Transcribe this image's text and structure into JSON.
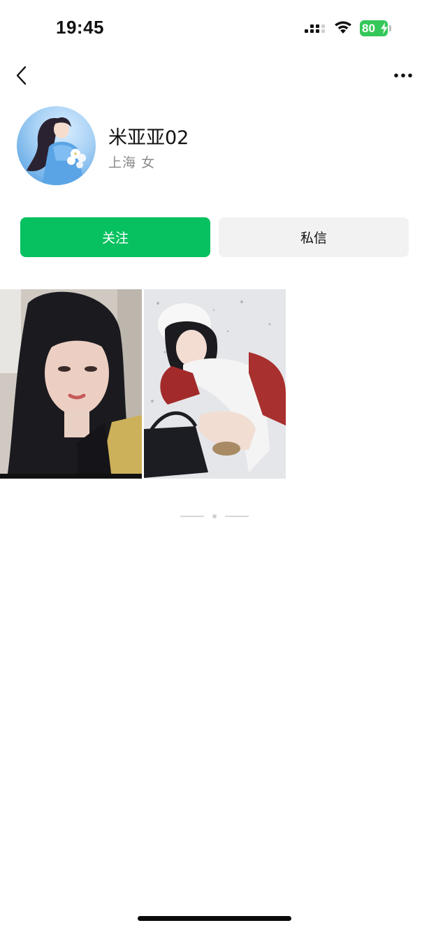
{
  "status_bar": {
    "time": "19:45",
    "battery": "80",
    "icons": [
      "signal-icon",
      "wifi-icon",
      "battery-icon",
      "charging-bolt-icon"
    ]
  },
  "nav": {
    "back_icon": "back-chevron-icon",
    "more_icon": "more-dots-icon"
  },
  "profile": {
    "name": "米亚亚02",
    "location": "上海",
    "gender": "女"
  },
  "actions": {
    "follow_label": "关注",
    "message_label": "私信"
  },
  "colors": {
    "accent": "#07c160",
    "secondary_button": "#f2f2f2",
    "battery": "#34c759",
    "meta_text": "#8a8a8a"
  },
  "photos": [
    {
      "subject": "portrait-girl-dark-hair"
    },
    {
      "subject": "girl-white-hat-snow"
    }
  ]
}
